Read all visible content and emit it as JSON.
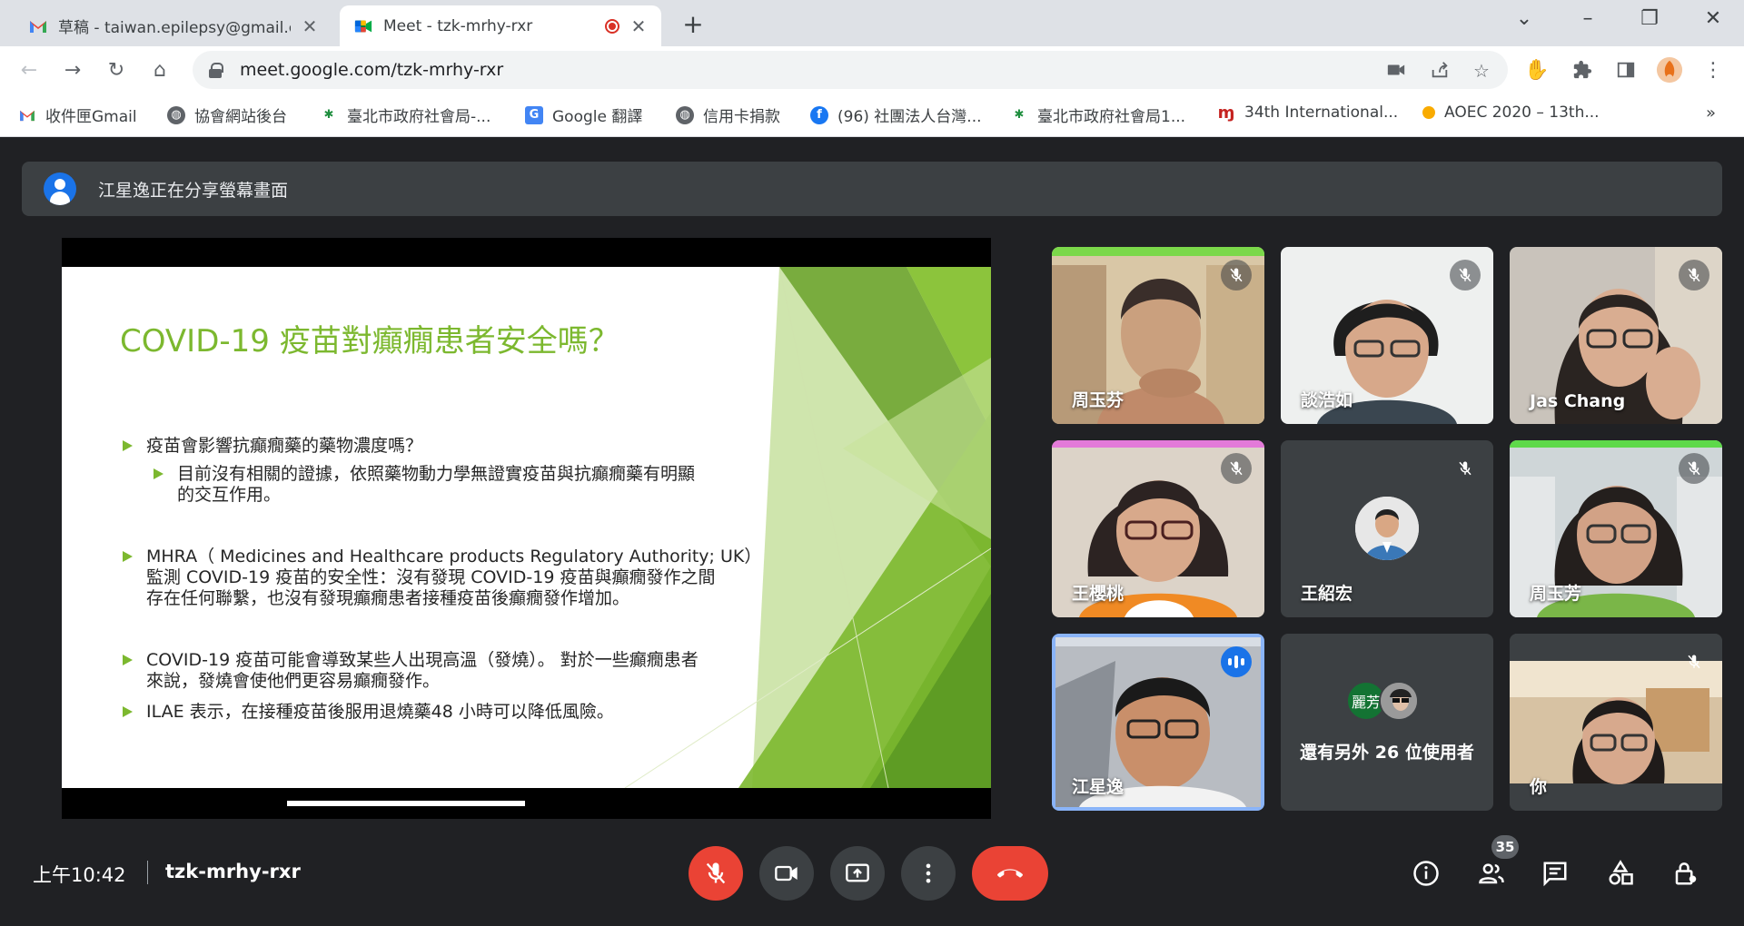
{
  "tabs": [
    {
      "title": "草稿 - taiwan.epilepsy@gmail.c",
      "icon": "gmail-icon",
      "active": false
    },
    {
      "title": "Meet - tzk-mrhy-rxr",
      "icon": "meet-icon",
      "active": true,
      "recording": true
    }
  ],
  "url": "meet.google.com/tzk-mrhy-rxr",
  "bookmarks": [
    {
      "label": "收件匣Gmail",
      "icon": "gmail-icon"
    },
    {
      "label": "協會網站後台",
      "icon": "globe-icon"
    },
    {
      "label": "臺北市政府社會局-...",
      "icon": "taipei-icon"
    },
    {
      "label": "Google 翻譯",
      "icon": "translate-icon"
    },
    {
      "label": "信用卡捐款",
      "icon": "globe-icon"
    },
    {
      "label": "(96) 社團法人台灣...",
      "icon": "facebook-icon"
    },
    {
      "label": "臺北市政府社會局1...",
      "icon": "taipei-icon"
    },
    {
      "label": "34th International...",
      "icon": "conference-icon"
    },
    {
      "label": "AOEC 2020 – 13th...",
      "icon": "aoec-icon"
    }
  ],
  "share_banner": "江星逸正在分享螢幕畫面",
  "slide": {
    "title": "COVID-19 疫苗對癲癇患者安全嗎？",
    "b1": "疫苗會影響抗癲癇藥的藥物濃度嗎？",
    "b1_sub_l1": "目前沒有相關的證據，依照藥物動力學無證實疫苗與抗癲癇藥有明顯",
    "b1_sub_l2": "的交互作用。",
    "b2_l1": "MHRA（ Medicines and Healthcare products Regulatory Authority; UK）",
    "b2_l2": "監測 COVID-19 疫苗的安全性：沒有發現 COVID-19 疫苗與癲癇發作之間",
    "b2_l3": "存在任何聯繫，也沒有發現癲癇患者接種疫苗後癲癇發作增加。",
    "b3_l1": "COVID-19 疫苗可能會導致某些人出現高溫（發燒）。 對於一些癲癇患者",
    "b3_l2": "來說，發燒會使他們更容易癲癇發作。",
    "b4": "ILAE 表示，在接種疫苗後服用退燒藥48 小時可以降低風險。"
  },
  "participants": [
    {
      "name": "周玉芬",
      "muted": true
    },
    {
      "name": "談浩如",
      "muted": true
    },
    {
      "name": "Jas Chang",
      "muted": true
    },
    {
      "name": "王櫻桃",
      "muted": true
    },
    {
      "name": "王紹宏",
      "muted": true
    },
    {
      "name": "周玉芳",
      "muted": true
    },
    {
      "name": "江星逸",
      "muted": false,
      "speaking": true
    },
    {
      "name": "你",
      "muted": true
    }
  ],
  "others": {
    "avatar_label": "麗芳",
    "text": "還有另外 26 位使用者"
  },
  "footer": {
    "time": "上午10:42",
    "meeting_code": "tzk-mrhy-rxr",
    "people_count": "35"
  },
  "colors": {
    "slide_green": "#7cb82f",
    "meet_bg": "#202124",
    "hangup_red": "#ea4335",
    "speaking_blue": "#1a73e8"
  }
}
